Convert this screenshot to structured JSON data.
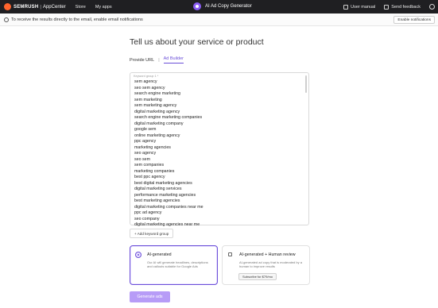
{
  "topbar": {
    "brand": "SEMRUSH",
    "separator": "|",
    "product": "AppCenter",
    "nav": [
      "Store",
      "My apps"
    ],
    "app_title": "AI Ad Copy Generator",
    "user_manual": "User manual",
    "send_feedback": "Send feedback"
  },
  "notice": {
    "text": "To receive the results directly to the email, enable email notifications",
    "button": "Enable notifications"
  },
  "main": {
    "heading": "Tell us about your service or product",
    "tabs": [
      "Provide URL",
      "Ad Builder"
    ],
    "tab_separator": "|",
    "keyword_label": "Keyword group 1 *",
    "keywords": [
      "sem agency",
      "seo sem agency",
      "search engine marketing",
      "sem marketing",
      "sem marketing agency",
      "digital marketing agency",
      "search engine marketing companies",
      "digital marketing company",
      "google sem",
      "online marketing agency",
      "ppc agency",
      "marketing agencies",
      "seo agency",
      "seo sem",
      "sem companies",
      "marketing companies",
      "best ppc agency",
      "best digital marketing agencies",
      "digital marketing services",
      "performance marketing agencies",
      "best marketing agencies",
      "digital marketing companies near me",
      "ppc ad agency",
      "seo company",
      "digital marketing agencies near me"
    ],
    "add_group": "+ Add keyword group",
    "options": [
      {
        "title": "AI-generated",
        "desc": "Our AI will generate headlines, descriptions and callouts suitable for Google Ads"
      },
      {
        "title": "AI-generated + Human review",
        "desc": "AI-generated ad copy that is moderated by a human to improve results",
        "button": "Subscribe for $79/mo"
      }
    ],
    "generate": "Generate ads"
  },
  "colors": {
    "accent": "#6b4fd8",
    "topbar": "#1f1f22",
    "generate": "#b79cf7",
    "brand_mark": "#ff642d"
  }
}
